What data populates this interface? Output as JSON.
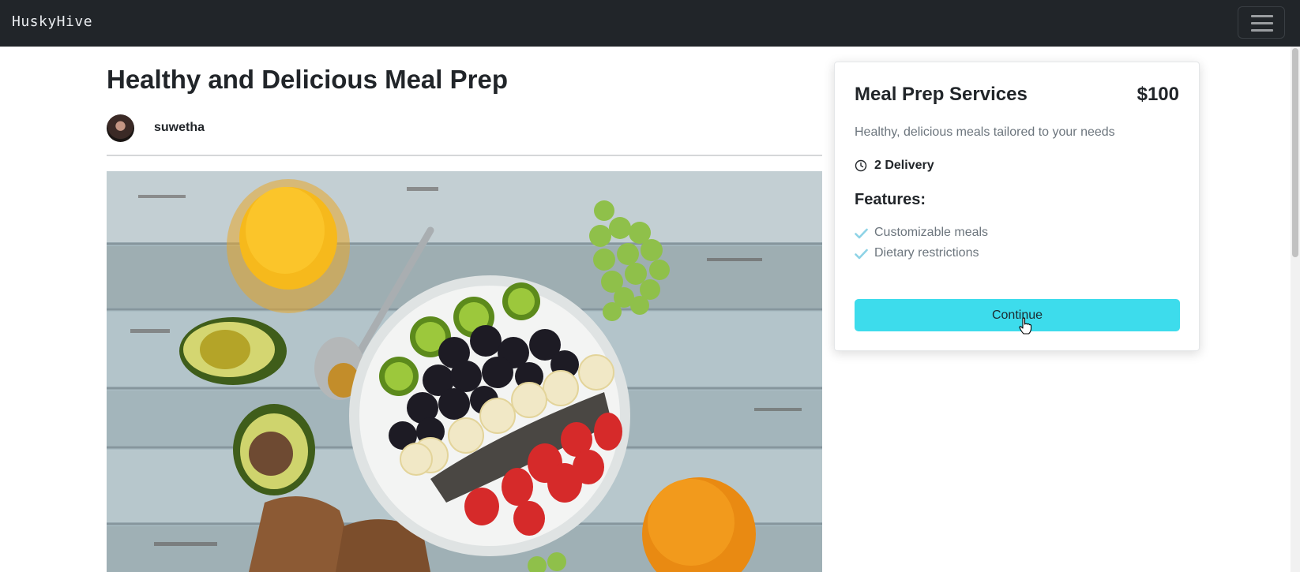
{
  "navbar": {
    "brand": "HuskyHive",
    "menu_icon": "hamburger-menu-icon"
  },
  "post": {
    "title": "Healthy and Delicious Meal Prep",
    "author": {
      "name": "suwetha",
      "avatar_icon": "user-avatar"
    },
    "image_description": "meal prep food photo"
  },
  "service_card": {
    "title": "Meal Prep Services",
    "price": "$100",
    "description": "Healthy, delicious meals tailored to your needs",
    "delivery_icon": "clock-icon",
    "delivery": "2 Delivery",
    "features_heading": "Features:",
    "features": [
      {
        "label": "Customizable meals",
        "icon": "check-icon"
      },
      {
        "label": "Dietary restrictions",
        "icon": "check-icon"
      }
    ],
    "button_label": "Continue"
  },
  "colors": {
    "navbar_bg": "#212529",
    "accent_button": "#3ddcec",
    "check_color": "#8ed3e6",
    "muted_text": "#6c757d"
  }
}
